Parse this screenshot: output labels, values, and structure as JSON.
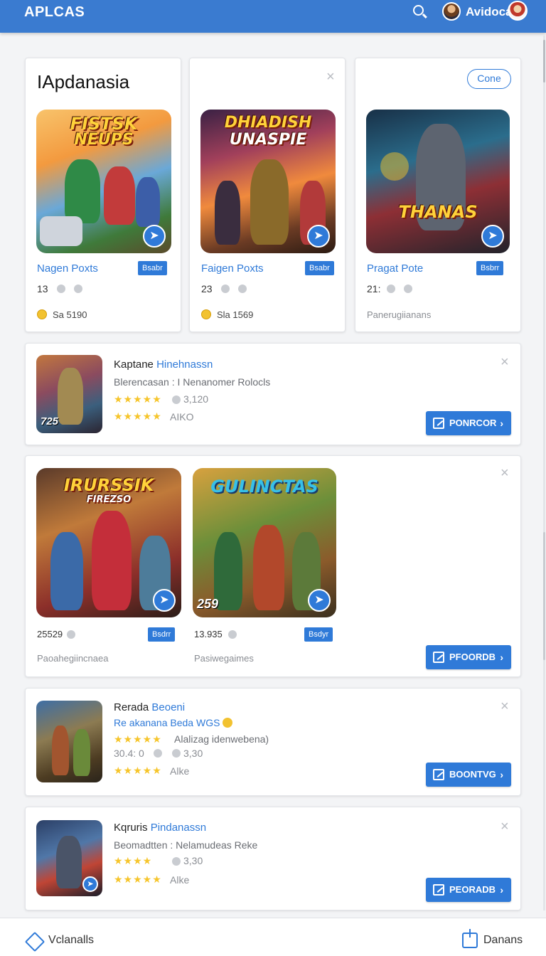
{
  "header": {
    "brand": "APLCAS",
    "user_name": "Avidoca"
  },
  "featured": {
    "title": "IApdanasia",
    "pill_label": "Cone",
    "games": [
      {
        "art_title_line1": "FISTSK",
        "art_title_line2": "NEUPS",
        "name": "Nagen Poxts",
        "tag": "Bsabr",
        "count": "13",
        "footer_value": "Sa 5190"
      },
      {
        "art_title_line1": "DHIADISH",
        "art_title_line2": "UNASPIE",
        "name": "Faigen Poxts",
        "tag": "Bsabr",
        "count": "23",
        "footer_value": "Sla 1569"
      },
      {
        "art_title_line1": "THANAS",
        "art_title_line2": "",
        "name": "Pragat Pote",
        "tag": "Bsbrr",
        "count": "21:",
        "footer_value": "Panerugiianans"
      }
    ]
  },
  "list_items": [
    {
      "title": "Kaptane",
      "title_hl": "Hinehnassn",
      "sub": "Blerencasan : I Nenanomer Rolocls",
      "sub_color": "",
      "rating_value": "3,120",
      "rating_prefix": "",
      "rating_label": "AIKO",
      "corner_num": "725",
      "cta": "PONRCOR"
    },
    {
      "title": "Rerada",
      "title_hl": "Beoeni",
      "sub": "Re akanana  Beda WGS",
      "sub_color": "blue",
      "line2": "Alalizag idenwebena)",
      "rating_prefix": "30.4: 0",
      "rating_value": "3,30",
      "rating_label": "Alke",
      "corner_num": "",
      "cta": "BOONTVG"
    },
    {
      "title": "Kqruris",
      "title_hl": "Pindanassn",
      "sub": "Beomadtten : Nelamudeas Reke",
      "sub_color": "",
      "rating_prefix": "",
      "rating_value": "3,30",
      "rating_label": "Alke",
      "corner_num": "",
      "cta": "PEORADB"
    }
  ],
  "pair_card": {
    "games": [
      {
        "art_title_line1": "IRURSSIK",
        "art_title_line2": "FIREZSO",
        "tag": "Bsdrr",
        "count": "25529",
        "footer": "Paoahegiincnaea"
      },
      {
        "art_title_line1": "GULINCTAS",
        "art_title_line2": "",
        "tag": "Bsdyr",
        "count": "13.935",
        "footer": "Pasiwegaimes",
        "corner_num": "259"
      }
    ],
    "cta": "PFOORDB"
  },
  "footer": {
    "left": "Vclanalls",
    "right": "Danans"
  },
  "colors": {
    "accent": "#2f7ad8",
    "header": "#3a7bd0",
    "stars": "#f6c52b"
  },
  "icons": [
    "search-icon",
    "close-icon",
    "share-icon",
    "edit-icon",
    "chevron-right-icon",
    "coin-icon",
    "home-icon",
    "export-icon"
  ]
}
